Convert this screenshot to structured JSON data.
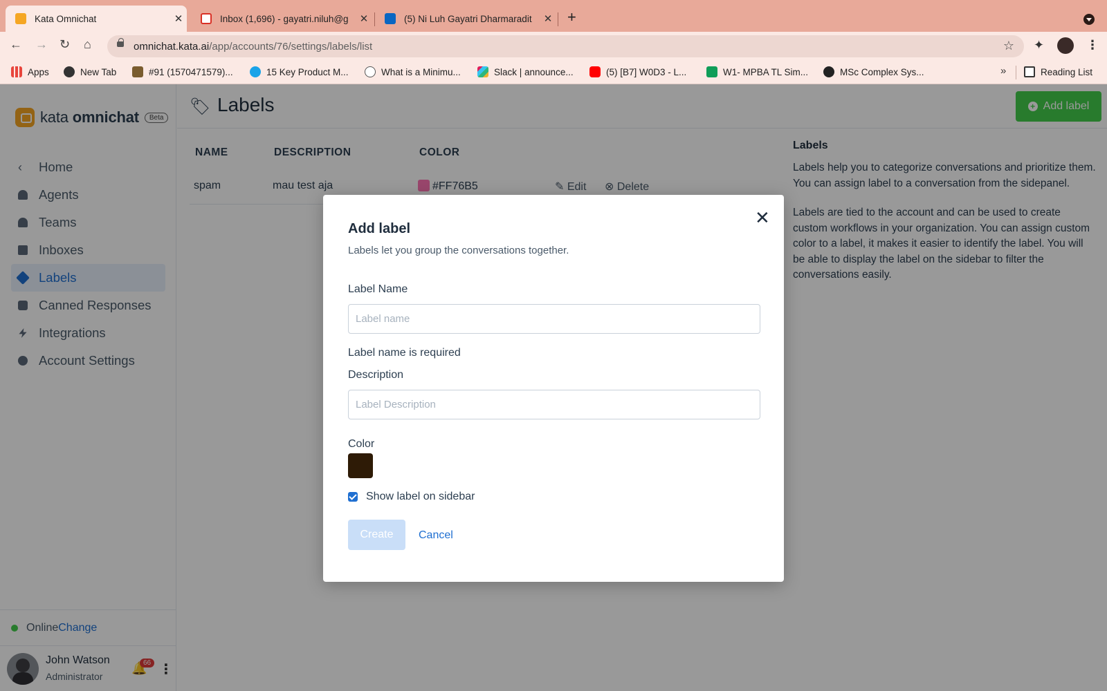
{
  "browser": {
    "tabs": [
      {
        "title": "Kata Omnichat",
        "active": true
      },
      {
        "title": "Inbox (1,696) - gayatri.niluh@g",
        "active": false
      },
      {
        "title": "(5) Ni Luh Gayatri Dharmaradit",
        "active": false
      }
    ],
    "url_host": "omnichat.kata.ai",
    "url_path": "/app/accounts/76/settings/labels/list",
    "bookmarks": [
      "Apps",
      "New Tab",
      "#91 (1570471579)...",
      "15 Key Product M...",
      "What is a Minimu...",
      "Slack | announce...",
      "(5) [B7] W0D3 - L...",
      "W1- MPBA TL Sim...",
      "MSc Complex Sys..."
    ],
    "more_bookmarks": "»",
    "reading_list": "Reading List"
  },
  "brand": {
    "name_light": "kata ",
    "name_bold": "omnichat",
    "beta": "Beta"
  },
  "sidebar": {
    "items": [
      {
        "label": "Home",
        "icon": "chevron-left-icon"
      },
      {
        "label": "Agents",
        "icon": "agents-icon"
      },
      {
        "label": "Teams",
        "icon": "teams-icon"
      },
      {
        "label": "Inboxes",
        "icon": "inbox-icon"
      },
      {
        "label": "Labels",
        "icon": "tag-icon",
        "active": true
      },
      {
        "label": "Canned Responses",
        "icon": "chat-icon"
      },
      {
        "label": "Integrations",
        "icon": "bolt-icon"
      },
      {
        "label": "Account Settings",
        "icon": "gear-icon"
      }
    ],
    "status": "Online",
    "status_change": "Change",
    "user": {
      "name": "John Watson",
      "role": "Administrator",
      "notifications": "66"
    }
  },
  "page": {
    "title": "Labels",
    "add_button": "Add label",
    "table": {
      "headers": [
        "NAME",
        "DESCRIPTION",
        "COLOR"
      ],
      "rows": [
        {
          "name": "spam",
          "description": "mau test aja",
          "color": "#FF76B5",
          "edit": "Edit",
          "delete": "Delete"
        }
      ]
    },
    "info": {
      "heading": "Labels",
      "paragraph1": "Labels help you to categorize conversations and prioritize them. You can assign label to a conversation from the sidepanel.",
      "paragraph2": "Labels are tied to the account and can be used to create custom workflows in your organization. You can assign custom color to a label, it makes it easier to identify the label. You will be able to display the label on the sidebar to filter the conversations easily."
    }
  },
  "modal": {
    "title": "Add label",
    "subtitle": "Labels let you group the conversations together.",
    "name_label": "Label Name",
    "name_placeholder": "Label name",
    "name_value": "",
    "name_error": "Label name is required",
    "description_label": "Description",
    "description_placeholder": "Label Description",
    "description_value": "",
    "color_label": "Color",
    "color_value": "#2E1B06",
    "show_on_sidebar_label": "Show label on sidebar",
    "show_on_sidebar_checked": true,
    "create_button": "Create",
    "cancel_button": "Cancel"
  },
  "colors": {
    "accent": "#1F6FD1",
    "success": "#44CE4B",
    "brand": "#F5A623"
  }
}
